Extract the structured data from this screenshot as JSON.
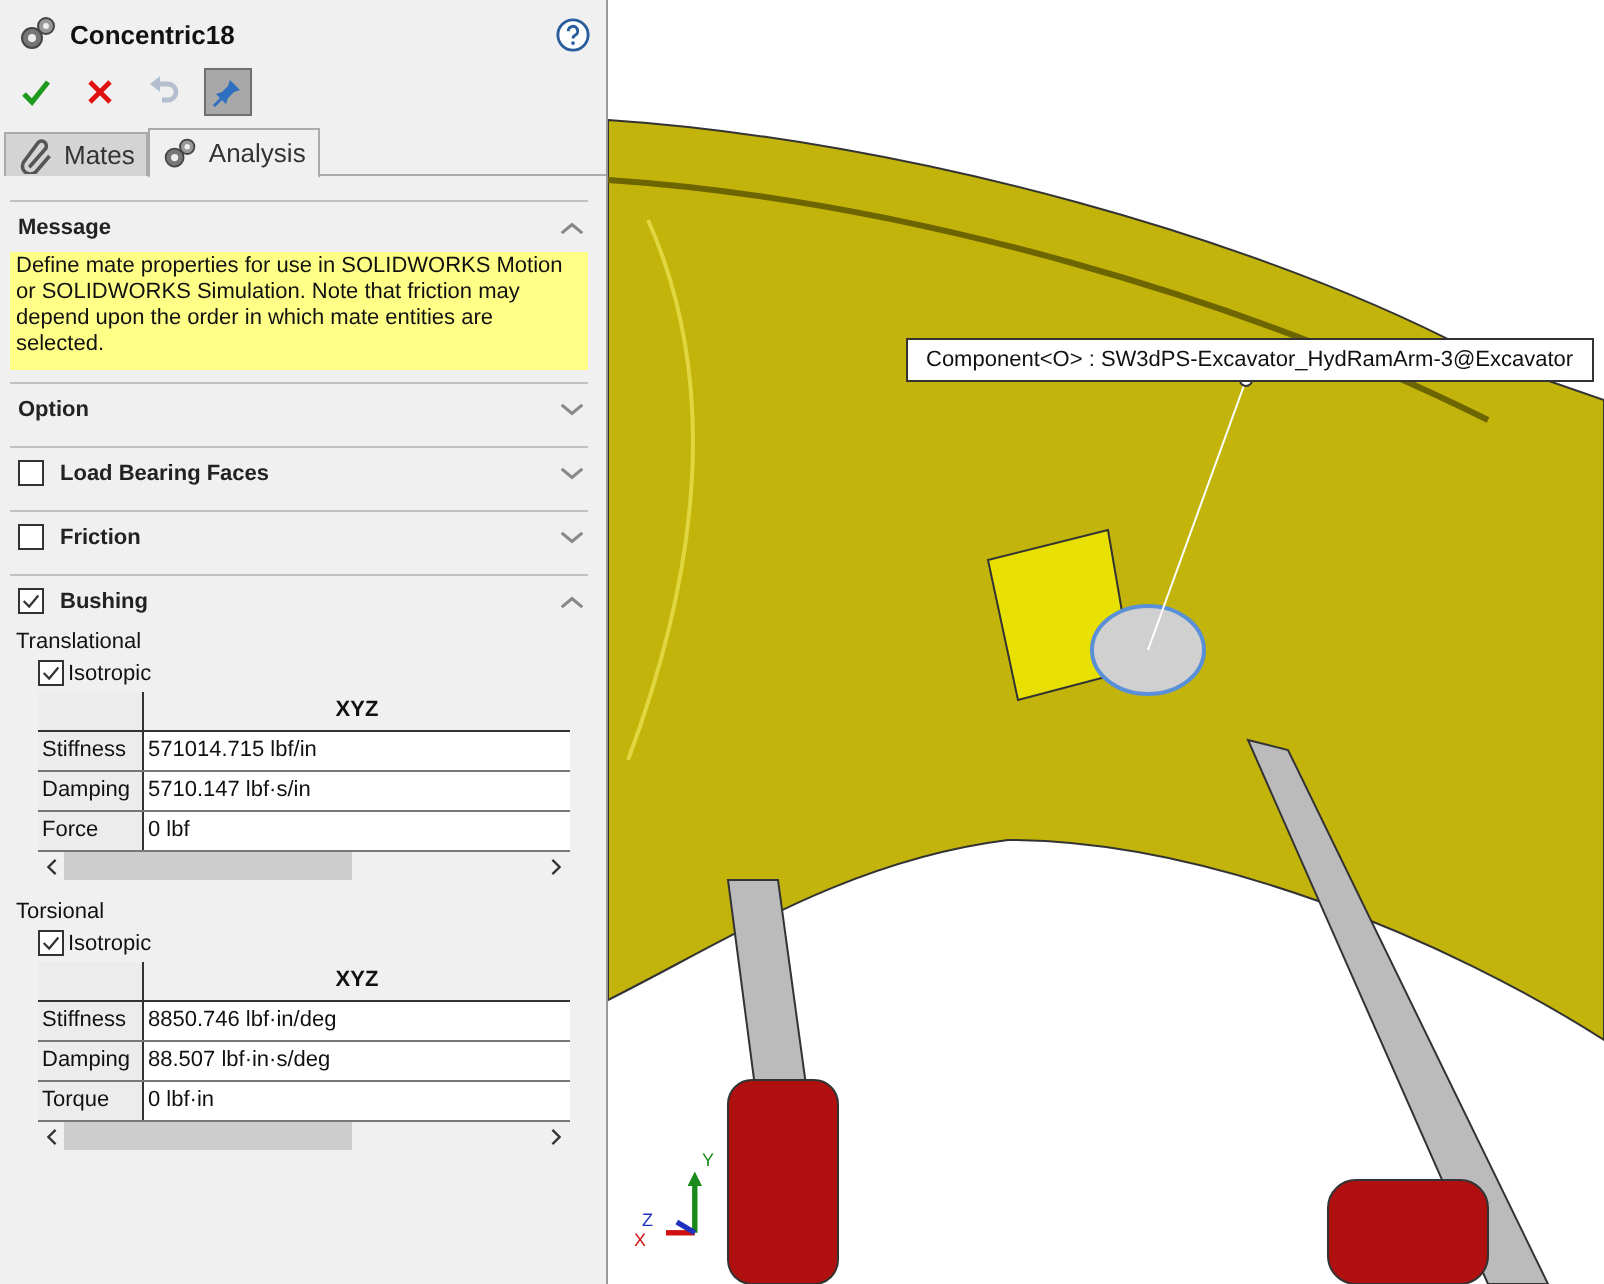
{
  "panel": {
    "title": "Concentric18",
    "toolbar": [
      {
        "kind": "ok",
        "disabled": false,
        "on": false
      },
      {
        "kind": "cancel",
        "disabled": false,
        "on": false
      },
      {
        "kind": "undo",
        "disabled": true,
        "on": false
      },
      {
        "kind": "pin",
        "disabled": false,
        "on": true
      }
    ],
    "tabs": [
      {
        "label": "Mates",
        "selected": false
      },
      {
        "label": "Analysis",
        "selected": true
      }
    ],
    "sections": [
      {
        "title": "Message",
        "kind": "plain",
        "expanded": true,
        "message": "Define mate properties for use in SOLIDWORKS Motion or SOLIDWORKS Simulation. Note that friction may depend upon the order in which mate entities are selected."
      },
      {
        "title": "Option",
        "kind": "plain",
        "expanded": false
      },
      {
        "title": "Load Bearing Faces",
        "kind": "checkbox",
        "checked": false,
        "expanded": false
      },
      {
        "title": "Friction",
        "kind": "checkbox",
        "checked": false,
        "expanded": false
      },
      {
        "title": "Bushing",
        "kind": "checkbox",
        "checked": true,
        "expanded": true,
        "groups": [
          {
            "label": "Translational",
            "isotropic": {
              "label": "Isotropic",
              "checked": true
            },
            "column": "XYZ",
            "rows": [
              {
                "name": "Stiffness",
                "value": "571014.715 lbf/in"
              },
              {
                "name": "Damping",
                "value": "5710.147 lbf·s/in"
              },
              {
                "name": "Force",
                "value": "0 lbf"
              }
            ]
          },
          {
            "label": "Torsional",
            "isotropic": {
              "label": "Isotropic",
              "checked": true
            },
            "column": "XYZ",
            "rows": [
              {
                "name": "Stiffness",
                "value": "8850.746 lbf·in/deg"
              },
              {
                "name": "Damping",
                "value": "88.507 lbf·in·s/deg"
              },
              {
                "name": "Torque",
                "value": "0 lbf·in"
              }
            ]
          }
        ]
      }
    ]
  },
  "viewport": {
    "tooltip": "Component<O> : SW3dPS-Excavator_HydRamArm-3@Excavator",
    "axes": {
      "x": "X",
      "y": "Y",
      "z": "Z"
    }
  }
}
